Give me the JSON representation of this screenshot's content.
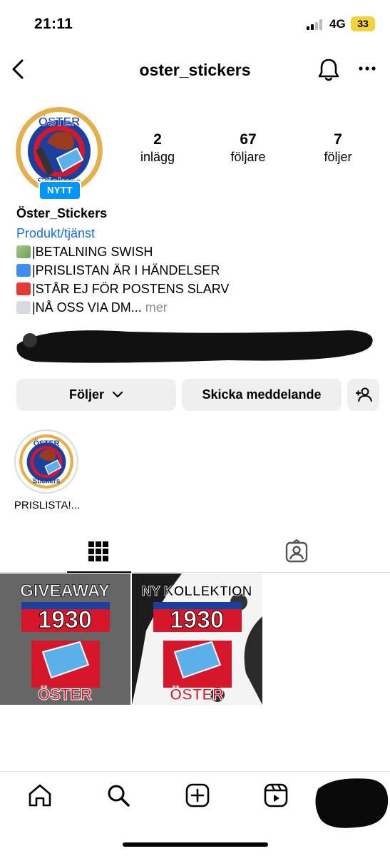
{
  "status_bar": {
    "time": "21:11",
    "network": "4G",
    "battery": "33"
  },
  "header": {
    "username": "oster_stickers"
  },
  "profile": {
    "badge": "NYTT",
    "display_name": "Öster_Stickers",
    "category": "Produkt/tjänst",
    "bio": [
      "|BETALNING SWISH",
      "|PRISLISTAN ÄR I HÄNDELSER",
      "|STÅR EJ FÖR POSTENS SLARV",
      "|NÅ OSS VIA DM..."
    ],
    "bio_more": "mer",
    "stats": [
      {
        "value": "2",
        "label": "inlägg"
      },
      {
        "value": "67",
        "label": "följare"
      },
      {
        "value": "7",
        "label": "följer"
      }
    ]
  },
  "actions": {
    "follow": "Följer",
    "message": "Skicka meddelande"
  },
  "highlights": [
    {
      "label": "PRISLISTA!..."
    }
  ],
  "posts": [
    {
      "headline": "GIVEAWAY",
      "year": "1930",
      "club": "ÖSTER"
    },
    {
      "headline": "NY KOLLEKTION",
      "year": "1930",
      "club": "ÖSTER"
    }
  ],
  "colors": {
    "accent": "#0095f6",
    "link": "#1a6fd6",
    "button_bg": "#efefef",
    "club_blue": "#1b3f9c",
    "club_red": "#d6162a"
  }
}
